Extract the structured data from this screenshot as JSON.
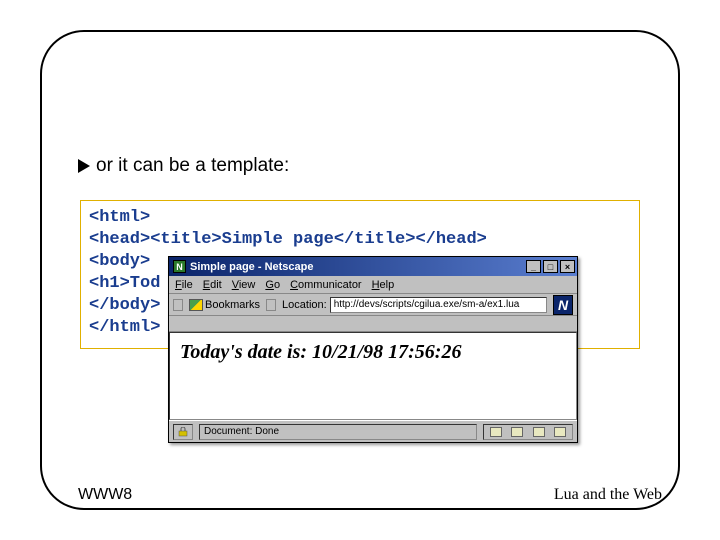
{
  "bullet": {
    "text": "or it can be a template:"
  },
  "code": {
    "line1": "<html>",
    "line2": "<head><title>Simple page</title></head>",
    "line3": "<body>",
    "line4": "<h1>Tod",
    "line5": "</body>",
    "line6": "</html>"
  },
  "browser": {
    "title": "Simple page - Netscape",
    "menu": {
      "file": "File",
      "edit": "Edit",
      "view": "View",
      "go": "Go",
      "communicator": "Communicator",
      "help": "Help"
    },
    "toolbar": {
      "bookmarks": "Bookmarks",
      "location_label": "Location:",
      "location_value": "http://devs/scripts/cgilua.exe/sm-a/ex1.lua"
    },
    "content_heading": "Today's date is: 10/21/98 17:56:26",
    "status": "Document: Done"
  },
  "footer": {
    "left": "WWW8",
    "right": "Lua and the Web"
  }
}
